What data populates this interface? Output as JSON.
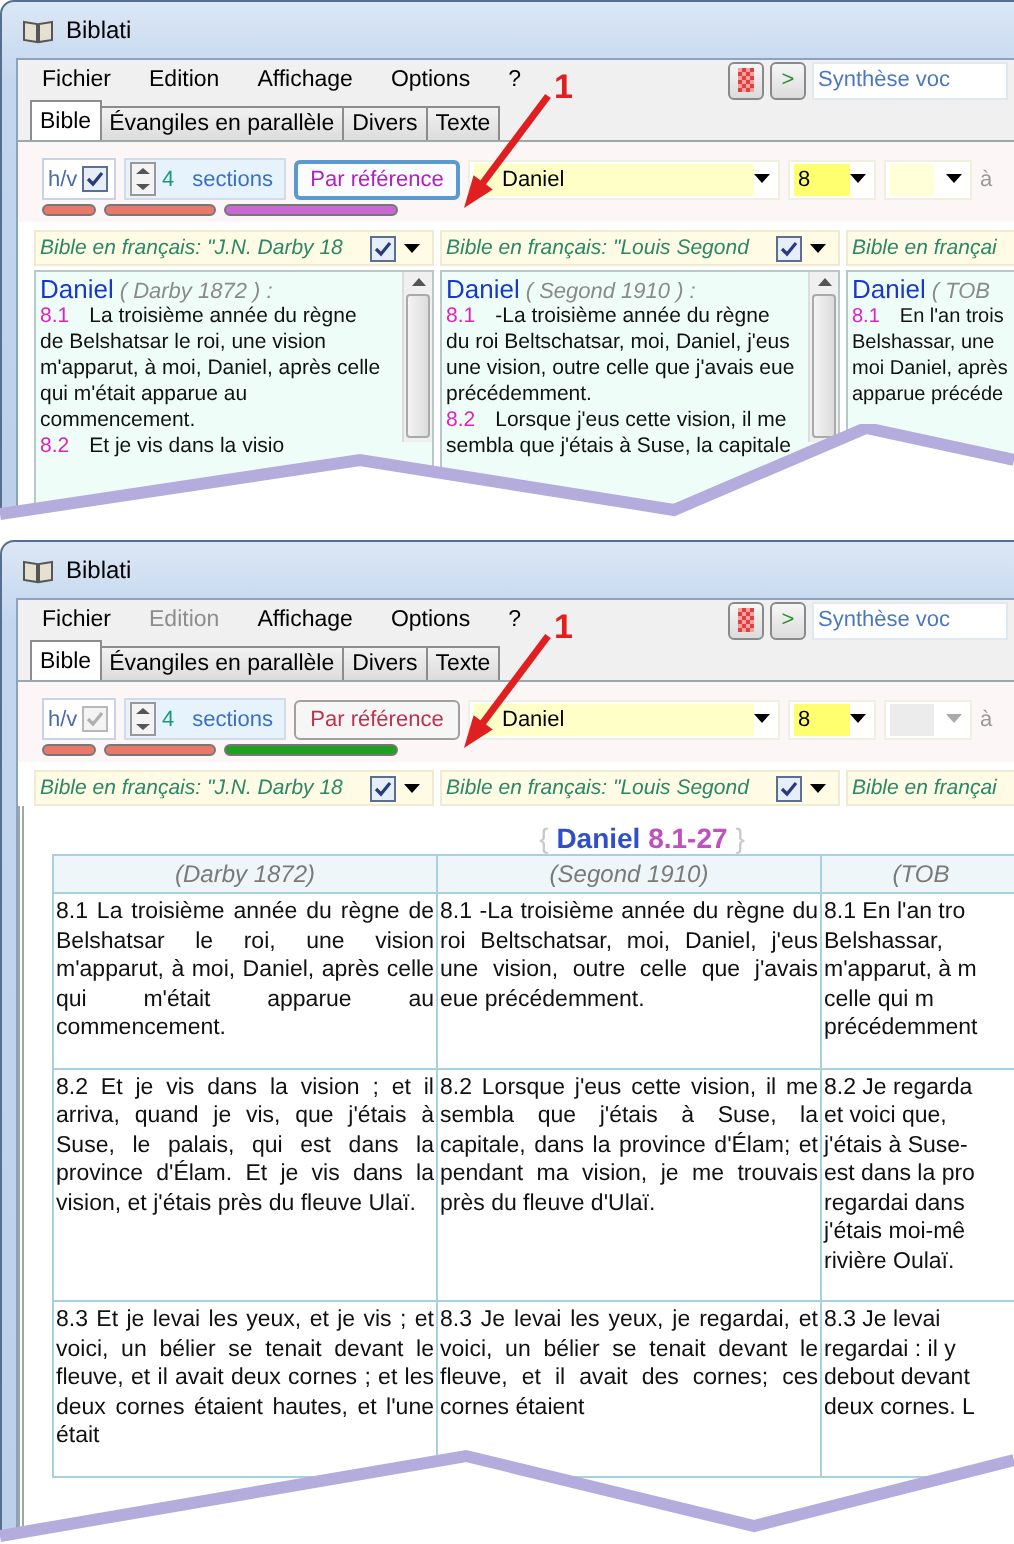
{
  "screens": [
    {
      "window": {
        "title": "Biblati"
      },
      "menu": [
        {
          "label": "Fichier",
          "disabled": false
        },
        {
          "label": "Edition",
          "disabled": false
        },
        {
          "label": "Affichage",
          "disabled": false
        },
        {
          "label": "Options",
          "disabled": false
        },
        {
          "label": "?",
          "disabled": false
        }
      ],
      "speech": {
        "play": ">",
        "field": "Synthèse voc"
      },
      "tabs": [
        {
          "label": "Bible",
          "selected": true
        },
        {
          "label": "Évangiles en parallèle",
          "selected": false
        },
        {
          "label": "Divers",
          "selected": false
        },
        {
          "label": "Texte",
          "selected": false
        }
      ],
      "toolbar": {
        "hv": {
          "label": "h/v",
          "checked": true,
          "disabled": false
        },
        "sections": {
          "value": "4",
          "label": "sections"
        },
        "mode_button": {
          "label": "Par référence",
          "kind": "focused"
        },
        "book": "Daniel",
        "chapter": "8",
        "verse_disabled": false,
        "to": "à",
        "bars": [
          {
            "color": "#e8786a"
          },
          {
            "color": "#e8786a"
          },
          {
            "color": "#c868d0"
          }
        ]
      },
      "versions": [
        {
          "label": "Bible en français: \"J.N. Darby 18",
          "checked": true
        },
        {
          "label": "Bible en français: \"Louis Segond",
          "checked": true
        },
        {
          "label": "Bible en françai"
        }
      ],
      "content": {
        "kind": "panes",
        "panes": [
          {
            "book": "Daniel",
            "version": "( Darby 1872 ) :",
            "verses": [
              {
                "ref": "8.1",
                "text": "La troisième année du règne\nde Belshatsar le roi, une vision\nm'apparut, à moi, Daniel, après celle\nqui m'était apparue au\ncommencement."
              },
              {
                "ref": "8.2",
                "text": "Et je vis dans la visio"
              }
            ]
          },
          {
            "book": "Daniel",
            "version": "( Segond 1910 ) :",
            "verses": [
              {
                "ref": "8.1",
                "text": "-La troisième année du règne\ndu roi Beltschatsar, moi, Daniel, j'eus\nune vision, outre celle que j'avais eue\nprécédemment."
              },
              {
                "ref": "8.2",
                "text": "Lorsque j'eus cette vision, il me\nsembla que j'étais à Suse, la capitale"
              }
            ]
          },
          {
            "book": "Daniel",
            "version": "( TOB",
            "verses": [
              {
                "ref": "8.1",
                "text": "En l'an trois\nBelshassar, une\nmoi Daniel, après\napparue précéde"
              }
            ]
          }
        ]
      },
      "annotation": {
        "label": "1"
      }
    },
    {
      "window": {
        "title": "Biblati"
      },
      "menu": [
        {
          "label": "Fichier",
          "disabled": false
        },
        {
          "label": "Edition",
          "disabled": true
        },
        {
          "label": "Affichage",
          "disabled": false
        },
        {
          "label": "Options",
          "disabled": false
        },
        {
          "label": "?",
          "disabled": false
        }
      ],
      "speech": {
        "play": ">",
        "field": "Synthèse voc"
      },
      "tabs": [
        {
          "label": "Bible",
          "selected": true
        },
        {
          "label": "Évangiles en parallèle",
          "selected": false
        },
        {
          "label": "Divers",
          "selected": false
        },
        {
          "label": "Texte",
          "selected": false
        }
      ],
      "toolbar": {
        "hv": {
          "label": "h/v",
          "checked": true,
          "disabled": true
        },
        "sections": {
          "value": "4",
          "label": "sections"
        },
        "mode_button": {
          "label": "Par référence",
          "kind": "normal"
        },
        "book": "Daniel",
        "chapter": "8",
        "verse_disabled": true,
        "to": "à",
        "bars": [
          {
            "color": "#e8786a"
          },
          {
            "color": "#e8786a"
          },
          {
            "color": "#20a020"
          }
        ]
      },
      "versions": [
        {
          "label": "Bible en français: \"J.N. Darby 18",
          "checked": true
        },
        {
          "label": "Bible en français: \"Louis Segond",
          "checked": true
        },
        {
          "label": "Bible en françai"
        }
      ],
      "content": {
        "kind": "table",
        "heading": {
          "book": "Daniel",
          "range": "8.1-27",
          "open": "{",
          "close": "}"
        },
        "columns": [
          "(Darby 1872)",
          "(Segond 1910)",
          "(TOB"
        ],
        "rows": [
          [
            "8.1 La troisième année du règne de Belshatsar le roi, une vision m'apparut, à moi, Daniel, après celle qui m'était apparue au commencement.",
            "8.1 -La troisième année du règne du roi Beltschatsar, moi, Daniel, j'eus une vision, outre celle que j'avais eue précédemment.",
            "8.1 En l'an tro\nBelshassar,\nm'apparut, à m\ncelle qui m\nprécédemment"
          ],
          [
            "8.2 Et je vis dans la vision ; et il arriva, quand je vis, que j'étais à Suse, le palais, qui est dans la province d'Élam. Et je vis dans la vision, et j'étais près du fleuve Ulaï.",
            "8.2 Lorsque j'eus cette vision, il me sembla que j'étais à Suse, la capitale, dans la province d'Élam; et pendant ma vision, je me trouvais près du fleuve d'Ulaï.",
            "8.2 Je regarda\net voici que,\nj'étais à Suse-\nest dans la pro\nregardai dans\nj'étais moi-mê\nrivière Oulaï."
          ],
          [
            "8.3 Et je levai les yeux, et je vis ; et voici, un bélier se tenait devant le fleuve, et il avait deux cornes ; et les deux cornes étaient hautes, et l'une était",
            "8.3 Je levai les yeux, je regardai, et voici, un bélier se tenait devant le fleuve, et il avait des cornes; ces cornes étaient",
            "8.3 Je levai\nregardai : il y\ndebout devant\ndeux cornes. L"
          ]
        ]
      },
      "annotation": {
        "label": "1"
      }
    }
  ]
}
